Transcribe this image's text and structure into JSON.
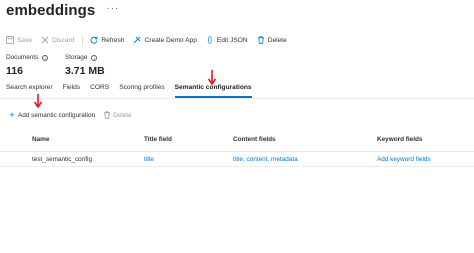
{
  "header": {
    "title": "embeddings",
    "more_label": "···"
  },
  "toolbar": {
    "save": "Save",
    "discard": "Discard",
    "refresh": "Refresh",
    "create_demo_app": "Create Demo App",
    "edit_json": "Edit JSON",
    "delete": "Delete"
  },
  "stats": {
    "documents": {
      "label": "Documents",
      "value": "116"
    },
    "storage": {
      "label": "Storage",
      "value": "3.71 MB"
    }
  },
  "tabs": [
    "Search explorer",
    "Fields",
    "CORS",
    "Scoring profiles",
    "Semantic configurations"
  ],
  "active_tab": "Semantic configurations",
  "sub_toolbar": {
    "add": "Add semantic configuration",
    "delete": "Delete"
  },
  "table": {
    "headers": [
      "Name",
      "Title field",
      "Content fields",
      "Keyword fields"
    ],
    "rows": [
      {
        "name": "test_semantic_config",
        "title": "title",
        "content": "title, content, metadata",
        "keyword": "Add keyword fields"
      }
    ]
  },
  "colors": {
    "accent": "#0078d4",
    "annotation_arrow": "#e81123"
  }
}
